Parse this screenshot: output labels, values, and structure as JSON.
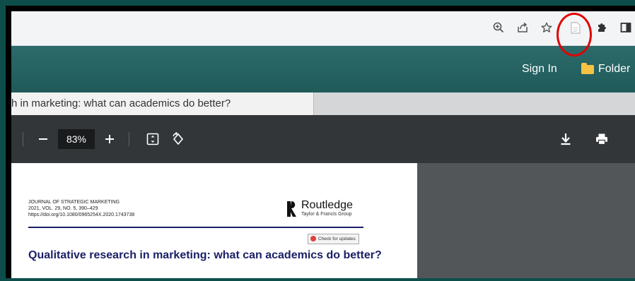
{
  "browser": {
    "icons": [
      "zoom-icon",
      "share-icon",
      "star-icon",
      "document-icon",
      "extensions-icon",
      "sidepanel-icon"
    ]
  },
  "site_header": {
    "sign_in": "Sign In",
    "folder": "Folder"
  },
  "doc_tab": {
    "title": "h in marketing: what can academics do better?"
  },
  "pdf_toolbar": {
    "zoom": "83%"
  },
  "page": {
    "journal_name": "JOURNAL OF STRATEGIC MARKETING",
    "volume": "2021, VOL. 29, NO. 5, 390–429",
    "doi": "https://doi.org/10.1080/0965254X.2020.1743738",
    "publisher": "Routledge",
    "publisher_group": "Taylor & Francis Group",
    "check_updates": "Check for updates",
    "title": "Qualitative research in marketing: what can academics do better?"
  },
  "colors": {
    "header": "#1f5a59",
    "pdf_toolbar": "#323639",
    "title": "#1a1f66",
    "annotation": "#e10000"
  }
}
